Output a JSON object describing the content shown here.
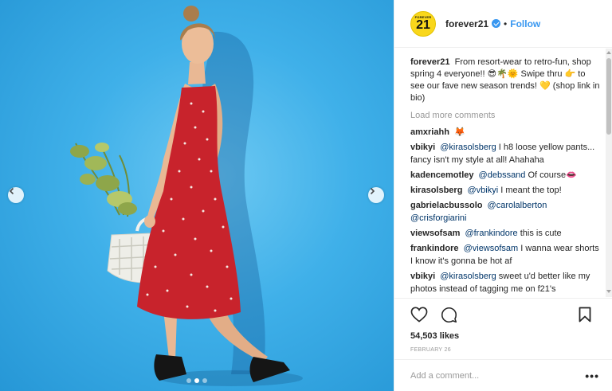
{
  "post": {
    "username": "forever21",
    "logo_small_text": "FOREVER",
    "logo_big_text": "21",
    "follow_label": "Follow",
    "separator": "•",
    "caption": {
      "username": "forever21",
      "text": "From resort-wear to retro-fun, shop spring 4 everyone!! 😎🌴🌞 Swipe thru 👉 to see our fave new season trends! 💛 (shop link in bio)"
    },
    "load_more_label": "Load more comments",
    "comments": [
      {
        "user": "amxriahh",
        "mention": "",
        "text": "🦊"
      },
      {
        "user": "vbikyi",
        "mention": "@kirasolsberg",
        "text": "I h8 loose yellow pants... fancy isn't my style at all! Ahahaha"
      },
      {
        "user": "kadencemotley",
        "mention": "@debssand",
        "text": "Of course👄"
      },
      {
        "user": "kirasolsberg",
        "mention": "@vbikyi",
        "text": "I meant the top!"
      },
      {
        "user": "gabrielacbussolo",
        "mention": "@carolalberton @crisforgiarini",
        "text": ""
      },
      {
        "user": "viewsofsam",
        "mention": "@frankindore",
        "text": "this is cute"
      },
      {
        "user": "frankindore",
        "mention": "@viewsofsam",
        "text": "I wanna wear shorts I know it's gonna be hot af"
      },
      {
        "user": "vbikyi",
        "mention": "@kirasolsberg",
        "text": "sweet u'd better like my photos instead of tagging me on f21's"
      }
    ],
    "likes": "54,503 likes",
    "date": "FEBRUARY 26",
    "add_comment_placeholder": "Add a comment...",
    "more_options": "•••"
  },
  "carousel": {
    "slides_total": 3,
    "active_slide": 2
  },
  "colors": {
    "accent": "#3897f0",
    "background_blue": "#3fb0e9",
    "dress_red": "#c8232c",
    "logo_yellow": "#f9d71c"
  },
  "icons": {
    "prev": "chevron-left-icon",
    "next": "chevron-right-icon",
    "like": "heart-icon",
    "comment": "comment-icon",
    "save": "bookmark-icon",
    "verified": "verified-badge-icon"
  }
}
